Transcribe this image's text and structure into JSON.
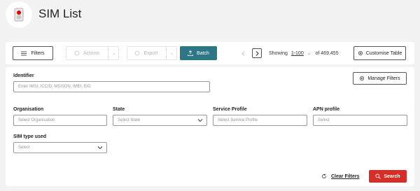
{
  "header": {
    "title": "SIM List",
    "logo_icon": "vodafone-sim-icon"
  },
  "toolbar": {
    "filters_label": "Filters",
    "actions_label": "Actions",
    "export_label": "Export",
    "batch_label": "Batch",
    "showing_label": "Showing",
    "range": "1-100",
    "of_total": "of 469,455",
    "customise_label": "Customise Table"
  },
  "filters": {
    "identifier": {
      "label": "Identifier",
      "placeholder": "Enter IMSI, ICCID, MSISDN, IMEI, EID"
    },
    "organisation": {
      "label": "Organisation",
      "placeholder": "Select Organisation"
    },
    "state": {
      "label": "State",
      "placeholder": "Select State"
    },
    "service_profile": {
      "label": "Service Profile",
      "placeholder": "Select Service Profile"
    },
    "apn_profile": {
      "label": "APN profile",
      "placeholder": "Select"
    },
    "sim_type": {
      "label": "SIM type used",
      "placeholder": "Select"
    },
    "manage_filters_label": "Manage Filters",
    "clear_filters_label": "Clear Filters",
    "search_label": "Search"
  },
  "colors": {
    "batch": "#2d7785",
    "search": "#d72d26",
    "brand": "#e60000"
  }
}
